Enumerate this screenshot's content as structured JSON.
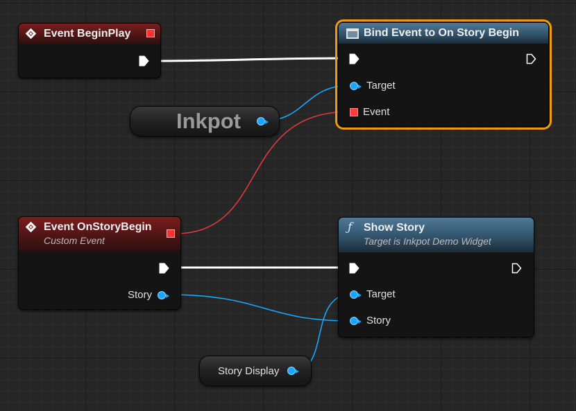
{
  "nodes": {
    "begin_play": {
      "title": "Event BeginPlay"
    },
    "bind_event": {
      "title": "Bind Event to On Story Begin",
      "target_label": "Target",
      "event_label": "Event"
    },
    "inkpot_var": {
      "label": "Inkpot"
    },
    "on_story_begin": {
      "title": "Event OnStoryBegin",
      "subtitle": "Custom Event",
      "story_label": "Story"
    },
    "show_story": {
      "title": "Show Story",
      "subtitle": "Target is Inkpot Demo Widget",
      "target_label": "Target",
      "story_label": "Story"
    },
    "story_display_var": {
      "label": "Story Display"
    }
  },
  "colors": {
    "exec_wire": "#ffffff",
    "object_wire": "#1aa6ff",
    "delegate_wire": "#e03a3a",
    "selection": "#f09a12",
    "event_header": "#7a1d1d",
    "function_header": "#4f7a99"
  },
  "icons": {
    "event": "event-diamond-icon",
    "function": "function-f-icon",
    "bind": "window-icon"
  }
}
